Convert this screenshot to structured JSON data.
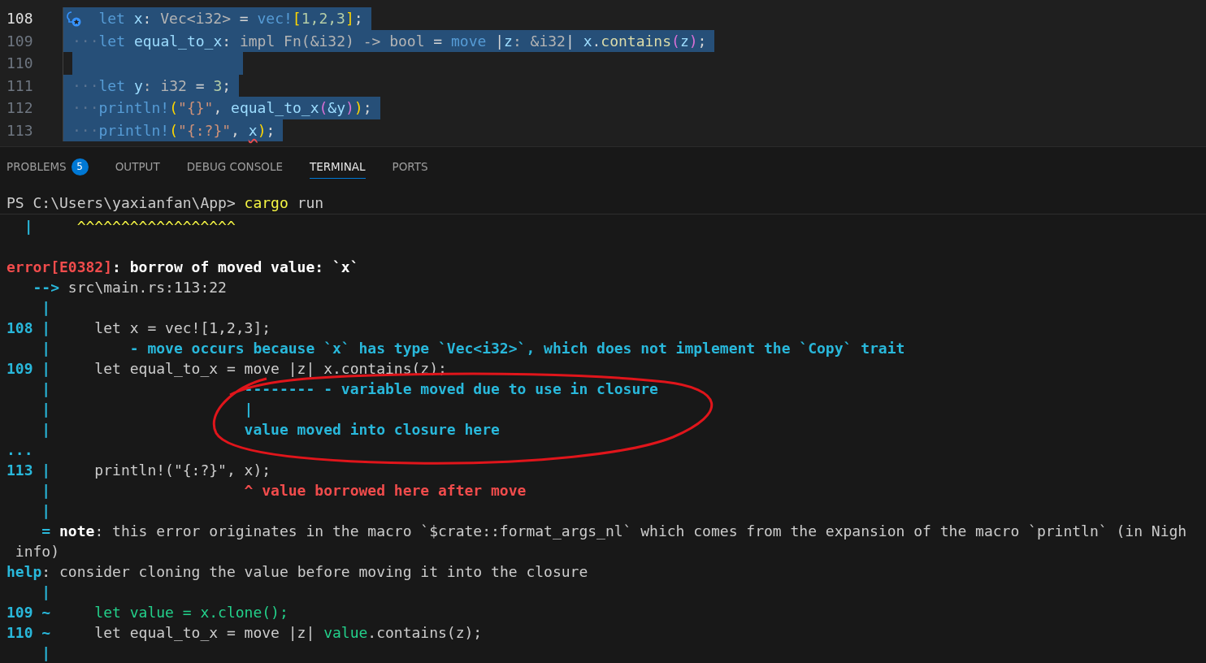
{
  "editor": {
    "lines": [
      {
        "number": "108",
        "active": true,
        "selected": true,
        "tokens": [
          {
            "text": "let ",
            "kind": "kw"
          },
          {
            "text": "x",
            "kind": "var"
          },
          {
            "text": ": ",
            "kind": "plain"
          },
          {
            "text": "Vec<i32>",
            "kind": "dim"
          },
          {
            "text": " = ",
            "kind": "plain"
          },
          {
            "text": "vec!",
            "kind": "macro"
          },
          {
            "text": "[",
            "kind": "b1"
          },
          {
            "text": "1,2,3",
            "kind": "num"
          },
          {
            "text": "]",
            "kind": "b1"
          },
          {
            "text": ";",
            "kind": "plain"
          }
        ]
      },
      {
        "number": "109",
        "active": false,
        "selected": true,
        "indent": "···",
        "tokens": [
          {
            "text": "let ",
            "kind": "kw"
          },
          {
            "text": "equal_to_x",
            "kind": "var"
          },
          {
            "text": ": ",
            "kind": "plain"
          },
          {
            "text": "impl Fn(&i32) -> bool",
            "kind": "dim"
          },
          {
            "text": " = ",
            "kind": "plain"
          },
          {
            "text": "move",
            "kind": "kw"
          },
          {
            "text": " |",
            "kind": "plain"
          },
          {
            "text": "z",
            "kind": "var"
          },
          {
            "text": ": &i32",
            "kind": "dim"
          },
          {
            "text": "| ",
            "kind": "plain"
          },
          {
            "text": "x",
            "kind": "var"
          },
          {
            "text": ".",
            "kind": "plain"
          },
          {
            "text": "contains",
            "kind": "fn"
          },
          {
            "text": "(",
            "kind": "b2"
          },
          {
            "text": "z",
            "kind": "var"
          },
          {
            "text": ")",
            "kind": "b2"
          },
          {
            "text": ";",
            "kind": "plain"
          }
        ]
      },
      {
        "number": "110",
        "active": false,
        "selected": true
      },
      {
        "number": "111",
        "active": false,
        "selected": true,
        "indent": "···",
        "tokens": [
          {
            "text": "let ",
            "kind": "kw"
          },
          {
            "text": "y",
            "kind": "var"
          },
          {
            "text": ": i32",
            "kind": "dim"
          },
          {
            "text": " = ",
            "kind": "plain"
          },
          {
            "text": "3",
            "kind": "num"
          },
          {
            "text": ";",
            "kind": "plain"
          }
        ]
      },
      {
        "number": "112",
        "active": false,
        "selected": true,
        "indent": "···",
        "tokens": [
          {
            "text": "println!",
            "kind": "macro"
          },
          {
            "text": "(",
            "kind": "b1"
          },
          {
            "text": "\"{}\"",
            "kind": "str"
          },
          {
            "text": ", ",
            "kind": "plain"
          },
          {
            "text": "equal_to_x",
            "kind": "var"
          },
          {
            "text": "(",
            "kind": "b2"
          },
          {
            "text": "&y",
            "kind": "var"
          },
          {
            "text": ")",
            "kind": "b2"
          },
          {
            "text": ")",
            "kind": "b1"
          },
          {
            "text": ";",
            "kind": "plain"
          }
        ]
      },
      {
        "number": "113",
        "active": false,
        "selected": true,
        "indent": "···",
        "tokens": [
          {
            "text": "println!",
            "kind": "macro"
          },
          {
            "text": "(",
            "kind": "b1"
          },
          {
            "text": "\"{:?}\"",
            "kind": "str"
          },
          {
            "text": ", ",
            "kind": "plain"
          },
          {
            "text": "x",
            "kind": "varerr"
          },
          {
            "text": ")",
            "kind": "b1"
          },
          {
            "text": ";",
            "kind": "plain"
          }
        ]
      }
    ]
  },
  "panel_tabs": [
    {
      "label": "PROBLEMS",
      "badge": "5",
      "selected": false
    },
    {
      "label": "OUTPUT",
      "selected": false
    },
    {
      "label": "DEBUG CONSOLE",
      "selected": false
    },
    {
      "label": "TERMINAL",
      "selected": true
    },
    {
      "label": "PORTS",
      "selected": false
    }
  ],
  "terminal": {
    "prompt": [
      {
        "text": "PS C:\\Users\\yaxianfan\\App> ",
        "kind": "plain"
      },
      {
        "text": "cargo",
        "kind": "yellow"
      },
      {
        "text": " run",
        "kind": "plain"
      }
    ],
    "previous_output": [
      {
        "text": "  |",
        "kind": "gutter"
      },
      {
        "text": "     ^^^^^^^^^^^^^^^^^^",
        "kind": "yellow"
      }
    ],
    "lines": [
      {
        "segments": [
          {
            "text": "error[E0382]",
            "kind": "error"
          },
          {
            "text": ": borrow of moved value: `x`",
            "kind": "bold"
          }
        ]
      },
      {
        "segments": [
          {
            "text": "   -->",
            "kind": "gutter"
          },
          {
            "text": " src\\main.rs:113:22",
            "kind": "plain"
          }
        ]
      },
      {
        "segments": [
          {
            "text": "    |",
            "kind": "gutter"
          }
        ]
      },
      {
        "segments": [
          {
            "text": "108 |",
            "kind": "gutter"
          },
          {
            "text": "     let x = vec![1,2,3];",
            "kind": "plain"
          }
        ]
      },
      {
        "segments": [
          {
            "text": "    |",
            "kind": "gutter"
          },
          {
            "text": "         - move occurs because `x` has type `Vec<i32>`, which does not implement the `Copy` trait",
            "kind": "label"
          }
        ]
      },
      {
        "segments": [
          {
            "text": "109 |",
            "kind": "gutter"
          },
          {
            "text": "     let equal_to_x = move |z| x.contains(z);",
            "kind": "plain"
          }
        ]
      },
      {
        "segments": [
          {
            "text": "    |",
            "kind": "gutter"
          },
          {
            "text": "                      -------- - variable moved due to use in closure",
            "kind": "label"
          }
        ]
      },
      {
        "segments": [
          {
            "text": "    |",
            "kind": "gutter"
          },
          {
            "text": "                      |",
            "kind": "label"
          }
        ]
      },
      {
        "segments": [
          {
            "text": "    |",
            "kind": "gutter"
          },
          {
            "text": "                      value moved into closure here",
            "kind": "label"
          }
        ]
      },
      {
        "segments": [
          {
            "text": "...",
            "kind": "gutter"
          }
        ]
      },
      {
        "segments": [
          {
            "text": "113 |",
            "kind": "gutter"
          },
          {
            "text": "     println!(\"{:?}\", x);",
            "kind": "plain"
          }
        ]
      },
      {
        "segments": [
          {
            "text": "    |",
            "kind": "gutter"
          },
          {
            "text": "                      ^ value borrowed here after move",
            "kind": "error"
          }
        ]
      },
      {
        "segments": [
          {
            "text": "    |",
            "kind": "gutter"
          }
        ]
      },
      {
        "segments": [
          {
            "text": "    =",
            "kind": "gutter"
          },
          {
            "text": " note",
            "kind": "bold"
          },
          {
            "text": ": this error originates in the macro `$crate::format_args_nl` which comes from the expansion of the macro `println` (in Nigh",
            "kind": "plain"
          }
        ]
      },
      {
        "segments": [
          {
            "text": " info)",
            "kind": "plain"
          }
        ]
      },
      {
        "segments": [
          {
            "text": "help",
            "kind": "help"
          },
          {
            "text": ": consider cloning the value before moving it into the closure",
            "kind": "plain"
          }
        ]
      },
      {
        "segments": [
          {
            "text": "    |",
            "kind": "gutter"
          }
        ]
      },
      {
        "segments": [
          {
            "text": "109 ~",
            "kind": "gutter"
          },
          {
            "text": "     let value = x.clone();",
            "kind": "green"
          }
        ]
      },
      {
        "segments": [
          {
            "text": "110 ~",
            "kind": "gutter"
          },
          {
            "text": "     let equal_to_x = move |z| ",
            "kind": "plain"
          },
          {
            "text": "value",
            "kind": "green"
          },
          {
            "text": ".contains(z);",
            "kind": "plain"
          }
        ]
      },
      {
        "segments": [
          {
            "text": "    |",
            "kind": "gutter"
          }
        ]
      }
    ]
  }
}
